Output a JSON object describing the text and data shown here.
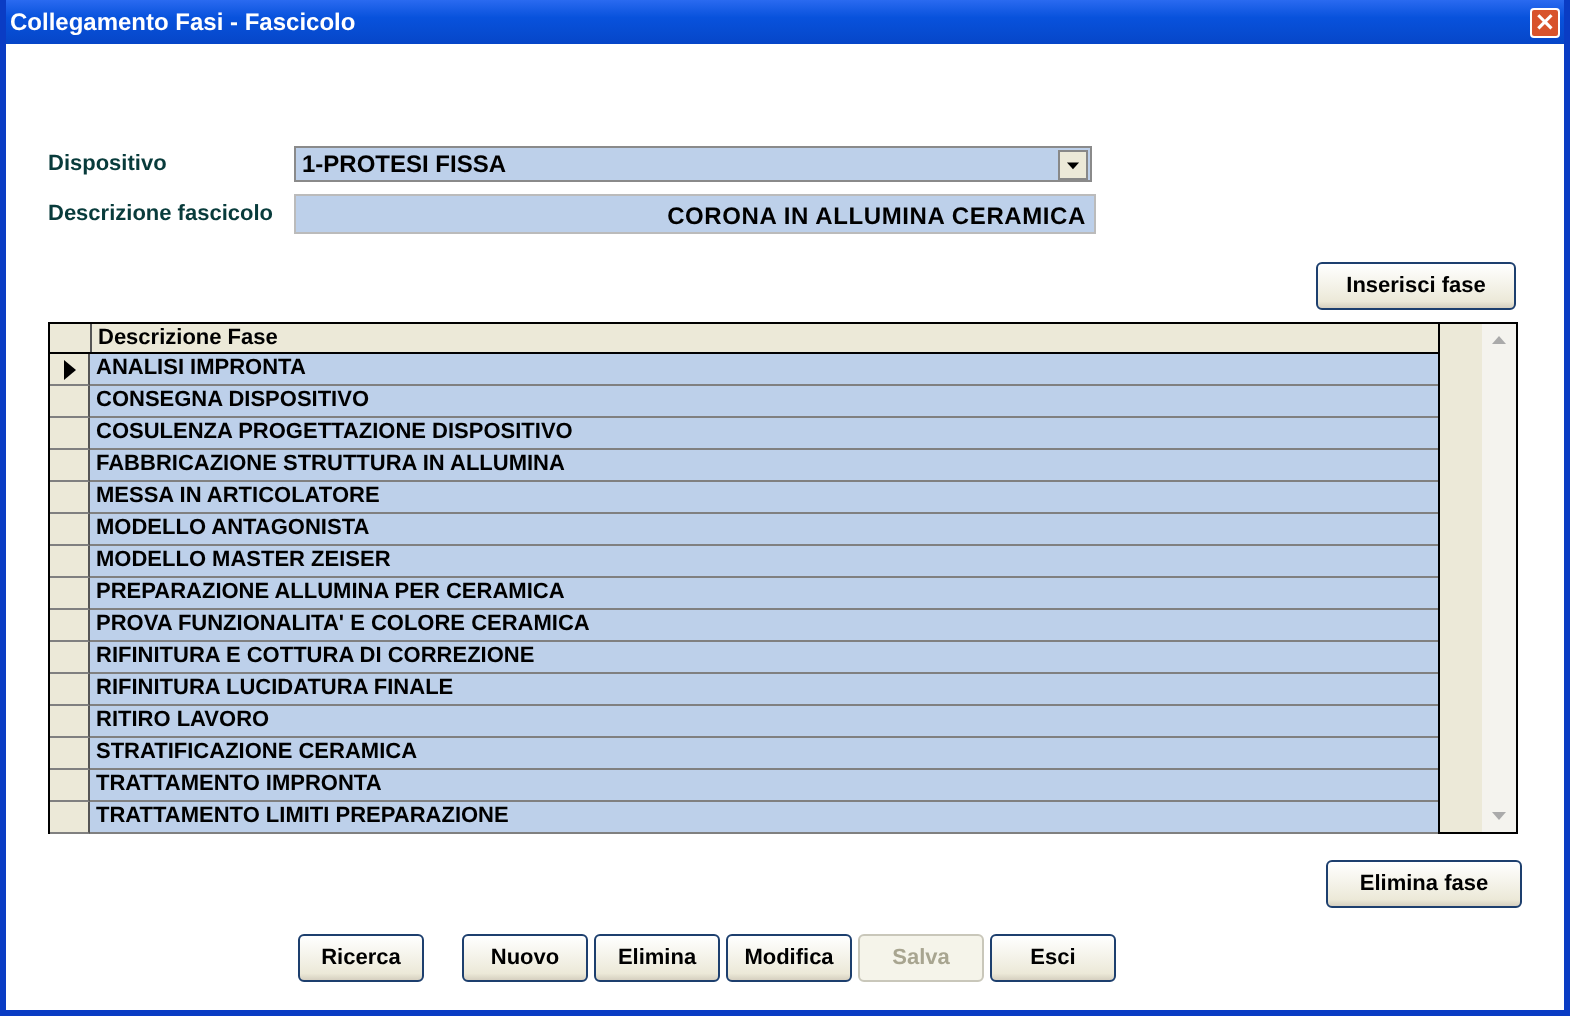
{
  "window": {
    "title": "Collegamento Fasi - Fascicolo",
    "close": "×"
  },
  "form": {
    "dispositivo_label": "Dispositivo",
    "dispositivo_value": "1-PROTESI FISSA",
    "descrizione_label": "Descrizione fascicolo",
    "descrizione_value": "CORONA IN ALLUMINA CERAMICA"
  },
  "insert_button": "Inserisci fase",
  "grid": {
    "column": "Descrizione Fase",
    "rows": [
      {
        "text": "ANALISI IMPRONTA",
        "selected": true
      },
      {
        "text": "CONSEGNA DISPOSITIVO",
        "selected": false
      },
      {
        "text": "COSULENZA PROGETTAZIONE DISPOSITIVO",
        "selected": false
      },
      {
        "text": "FABBRICAZIONE STRUTTURA IN ALLUMINA",
        "selected": false
      },
      {
        "text": "MESSA IN ARTICOLATORE",
        "selected": false
      },
      {
        "text": "MODELLO ANTAGONISTA",
        "selected": false
      },
      {
        "text": "MODELLO MASTER ZEISER",
        "selected": false
      },
      {
        "text": "PREPARAZIONE ALLUMINA PER CERAMICA",
        "selected": false
      },
      {
        "text": "PROVA FUNZIONALITA' E COLORE CERAMICA",
        "selected": false
      },
      {
        "text": "RIFINITURA E COTTURA DI CORREZIONE",
        "selected": false
      },
      {
        "text": "RIFINITURA LUCIDATURA FINALE",
        "selected": false
      },
      {
        "text": "RITIRO LAVORO",
        "selected": false
      },
      {
        "text": "STRATIFICAZIONE CERAMICA",
        "selected": false
      },
      {
        "text": "TRATTAMENTO IMPRONTA",
        "selected": false
      },
      {
        "text": "TRATTAMENTO LIMITI PREPARAZIONE",
        "selected": false
      }
    ]
  },
  "delete_button": "Elimina fase",
  "buttons": [
    {
      "label": "Ricerca",
      "disabled": false
    },
    {
      "label": "Nuovo",
      "disabled": false
    },
    {
      "label": "Elimina",
      "disabled": false
    },
    {
      "label": "Modifica",
      "disabled": false
    },
    {
      "label": "Salva",
      "disabled": true
    },
    {
      "label": "Esci",
      "disabled": false
    }
  ]
}
